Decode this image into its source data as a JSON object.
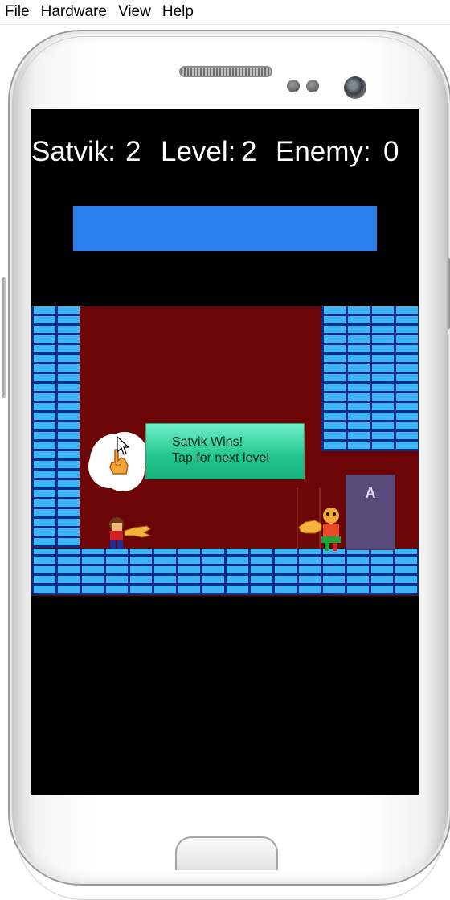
{
  "menu": {
    "items": [
      "File",
      "Hardware",
      "View",
      "Help"
    ]
  },
  "hud": {
    "player_label": "Satvik:",
    "player_score": "2",
    "level_label": "Level:",
    "level_value": "2",
    "enemy_label": "Enemy:",
    "enemy_score": "0"
  },
  "message": {
    "line1": "Satvik Wins!",
    "line2": "Tap for next level"
  },
  "door": {
    "letter": "A"
  },
  "colors": {
    "progress_bar": "#2a7fef",
    "field_background": "#6b0506",
    "brick": "#3db4f4",
    "message_box": "#22c58e"
  }
}
